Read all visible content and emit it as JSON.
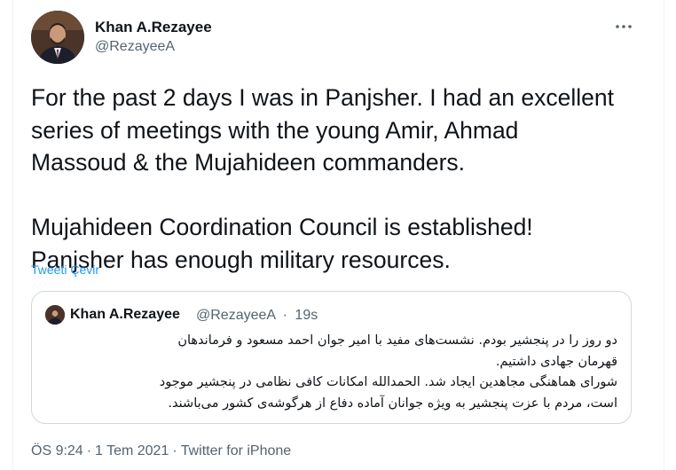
{
  "author": {
    "name": "Khan A.Rezayee",
    "handle": "@RezayeeA"
  },
  "more_menu": {
    "icon": "more-horizontal-icon"
  },
  "tweet": {
    "paragraphs": [
      "For the past 2 days I was in Panjsher. I had an excellent\nseries of meetings with the young Amir, Ahmad\nMassoud & the Mujahideen commanders.",
      "Mujahideen Coordination Council is established!\nPanjsher has enough military resources."
    ],
    "translate_label": "Tweeti Çevir"
  },
  "quoted_tweet": {
    "name": "Khan A.Rezayee",
    "handle": "@RezayeeA",
    "separator": "·",
    "time": "19s",
    "lines": [
      "دو روز را در پنجشیر بودم. نشست‌های مفید با امیر جوان احمد مسعود و فرماندهان",
      "قهرمان جهادی داشتیم.",
      "شورای هماهنگی مجاهدین ایجاد شد. الحمدالله امکانات کافی نظامی در پنجشیر موجود",
      "است، مردم با عزت پنجشیر به ویژه جوانان آماده دفاع از هرگوشه‌ی کشور می‌باشند."
    ]
  },
  "footer": {
    "time": "ÖS 9:24",
    "separator": "·",
    "date": "1 Tem 2021",
    "source": "Twitter for iPhone"
  },
  "colors": {
    "accent": "#1d9bf0",
    "secondary_text": "#536471",
    "border": "#cfd9de"
  }
}
